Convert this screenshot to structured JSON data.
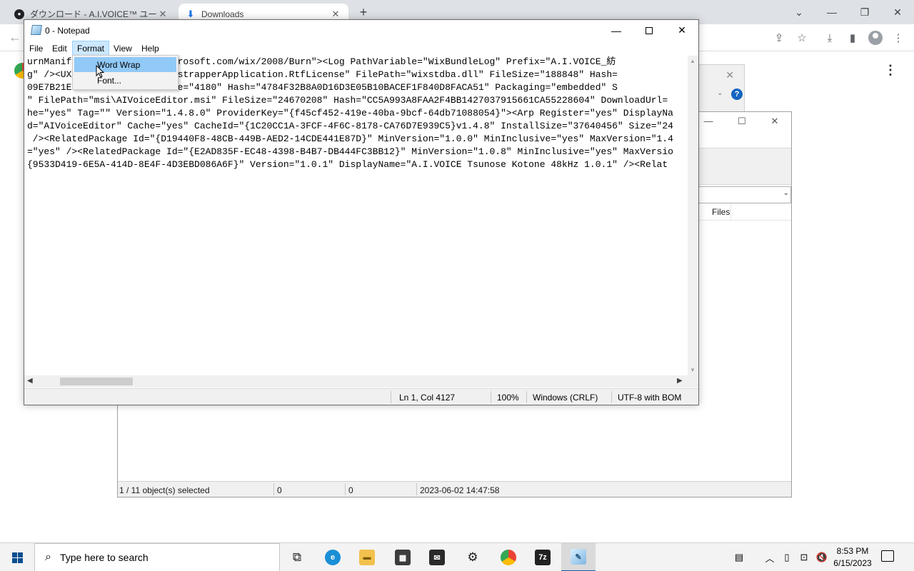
{
  "browser": {
    "tabs": [
      {
        "title": "ダウンロード - A.I.VOICE™ ユーザーサ",
        "favicon": "ai-voice-favicon"
      },
      {
        "title": "Downloads",
        "favicon": "download-icon"
      }
    ],
    "new_tab": "+"
  },
  "sevenzip": {
    "column_header": "Files",
    "status": {
      "selected": "1 / 11 object(s) selected",
      "size": "0",
      "packed": "0",
      "modified": "2023-06-02 14:47:58"
    }
  },
  "notepad": {
    "title": "0 - Notepad",
    "menu": {
      "file": "File",
      "edit": "Edit",
      "format": "Format",
      "view": "View",
      "help": "Help"
    },
    "format_menu": {
      "word_wrap": "Word Wrap",
      "font": "Font..."
    },
    "lines": [
      "urnManif         chemas.microsoft.com/wix/2008/Burn\"><Log PathVariable=\"WixBundleLog\" Prefix=\"A.I.VOICE_紡",
      "g\" /><UX         andardBootstrapperApplication.RtfLicense\" FilePath=\"wixstdba.dll\" FileSize=\"188848\" Hash=",
      "09E7B21E         d\" FileSize=\"4180\" Hash=\"4784F32B8A0D16D3E05B10BACEF1F840D8FACA51\" Packaging=\"embedded\" S",
      "\" FilePath=\"msi\\AIVoiceEditor.msi\" FileSize=\"24670208\" Hash=\"CC5A993A8FAA2F4BB1427037915661CA55228604\" DownloadUrl=",
      "he=\"yes\" Tag=\"\" Version=\"1.4.8.0\" ProviderKey=\"{f45cf452-419e-40ba-9bcf-64db71088054}\"><Arp Register=\"yes\" DisplayNa",
      "d=\"AIVoiceEditor\" Cache=\"yes\" CacheId=\"{1C20CC1A-3FCF-4F6C-8178-CA76D7E939C5}v1.4.8\" InstallSize=\"37640456\" Size=\"24",
      " /><RelatedPackage Id=\"{D19440F8-48CB-449B-AED2-14CDE441E87D}\" MinVersion=\"1.0.0\" MinInclusive=\"yes\" MaxVersion=\"1.4",
      "=\"yes\" /><RelatedPackage Id=\"{E2AD835F-EC48-4398-B4B7-DB444FC3BB12}\" MinVersion=\"1.0.8\" MinInclusive=\"yes\" MaxVersio",
      "{9533D419-6E5A-414D-8E4F-4D3EBD086A6F}\" Version=\"1.0.1\" DisplayName=\"A.I.VOICE Tsunose Kotone 48kHz 1.0.1\" /><Relat"
    ],
    "status": {
      "position": "Ln 1, Col 4127",
      "zoom": "100%",
      "line_ending": "Windows (CRLF)",
      "encoding": "UTF-8 with BOM"
    }
  },
  "taskbar": {
    "search_placeholder": "Type here to search",
    "time": "8:53 PM",
    "date": "6/15/2023",
    "sevenzip_label": "7z"
  }
}
